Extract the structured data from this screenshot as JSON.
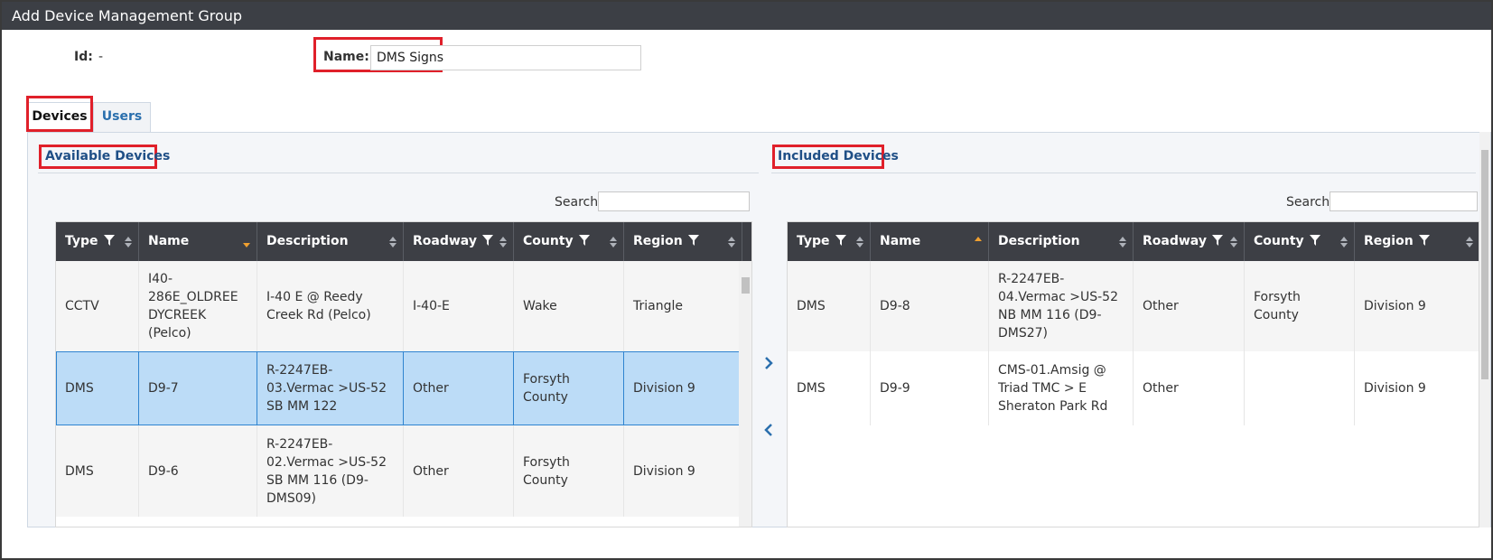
{
  "window": {
    "title": "Add Device Management Group"
  },
  "form": {
    "id_label": "Id:",
    "id_value": "-",
    "name_label": "Name:",
    "name_value": "DMS Signs"
  },
  "tabs": [
    {
      "label": "Devices",
      "active": true
    },
    {
      "label": "Users",
      "active": false
    }
  ],
  "available": {
    "title": "Available Devices",
    "search_label": "Search",
    "search_value": "",
    "columns": [
      "Type",
      "Name",
      "Description",
      "Roadway",
      "County",
      "Region"
    ],
    "rows": [
      {
        "type": "CCTV",
        "name": "I40-\n286E_OLDREE\nDYCREEK\n(Pelco)",
        "description": "I-40 E @ Reedy\nCreek Rd (Pelco)",
        "roadway": "I-40-E",
        "county": "Wake",
        "region": "Triangle"
      },
      {
        "type": "DMS",
        "name": "D9-7",
        "description": "R-2247EB-\n03.Vermac >US-52\nSB MM 122",
        "roadway": "Other",
        "county": "Forsyth\nCounty",
        "region": "Division 9"
      },
      {
        "type": "DMS",
        "name": "D9-6",
        "description": "R-2247EB-\n02.Vermac >US-52\nSB MM 116 (D9-\nDMS09)",
        "roadway": "Other",
        "county": "Forsyth\nCounty",
        "region": "Division 9"
      }
    ]
  },
  "included": {
    "title": "Included Devices",
    "search_label": "Search",
    "search_value": "",
    "columns": [
      "Type",
      "Name",
      "Description",
      "Roadway",
      "County",
      "Region"
    ],
    "rows": [
      {
        "type": "DMS",
        "name": "D9-8",
        "description": "R-2247EB-\n04.Vermac >US-52\nNB MM 116 (D9-\nDMS27)",
        "roadway": "Other",
        "county": "Forsyth\nCounty",
        "region": "Division 9"
      },
      {
        "type": "DMS",
        "name": "D9-9",
        "description": "CMS-01.Amsig @\nTriad TMC > E\nSheraton Park Rd",
        "roadway": "Other",
        "county": "",
        "region": "Division 9"
      }
    ]
  },
  "transfer": {
    "add_icon": "chevron-right-icon",
    "remove_icon": "chevron-left-icon"
  },
  "colors": {
    "titlebar": "#3c3f45",
    "header": "#3d3f45",
    "selected_row": "#bcdcf7",
    "highlight": "#e0202a",
    "link": "#2a6fad",
    "sort_active": "#f0a030"
  }
}
